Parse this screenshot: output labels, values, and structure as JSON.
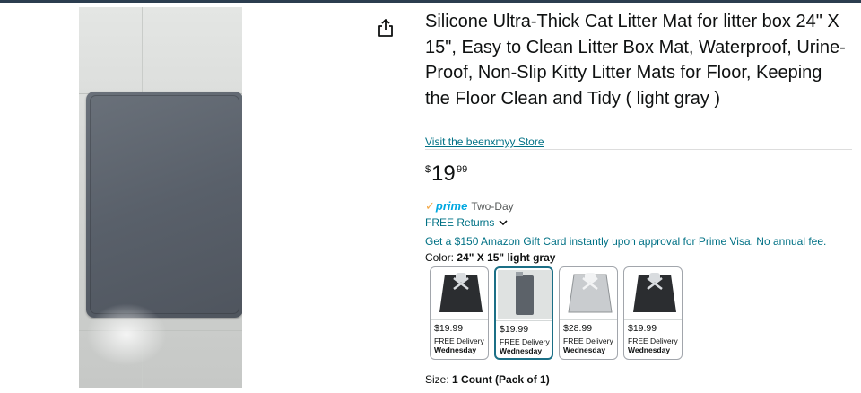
{
  "product": {
    "title": "Silicone Ultra-Thick Cat Litter Mat for litter box 24\" X 15\", Easy to Clean Litter Box Mat, Waterproof, Urine-Proof, Non-Slip Kitty Litter Mats for Floor, Keeping the Floor Clean and Tidy ( light gray )",
    "store_link": "Visit the beenxmyy Store"
  },
  "price": {
    "symbol": "$",
    "whole": "19",
    "fraction": "99"
  },
  "delivery": {
    "prime_check": "✓",
    "prime_word": "prime",
    "prime_speed": "Two-Day",
    "returns": "FREE Returns"
  },
  "offer": "Get a $150 Amazon Gift Card instantly upon approval for Prime Visa. No annual fee.",
  "color": {
    "label": "Color:",
    "value": "24\" X 15\" light gray"
  },
  "swatches": [
    {
      "price": "$19.99",
      "delivery": "FREE Delivery",
      "day": "Wednesday",
      "variant": "black-bone",
      "selected": false
    },
    {
      "price": "$19.99",
      "delivery": "FREE Delivery",
      "day": "Wednesday",
      "variant": "light-gray",
      "selected": true
    },
    {
      "price": "$28.99",
      "delivery": "FREE Delivery",
      "day": "Wednesday",
      "variant": "white-bone",
      "selected": false
    },
    {
      "price": "$19.99",
      "delivery": "FREE Delivery",
      "day": "Wednesday",
      "variant": "black-bone",
      "selected": false
    }
  ],
  "size": {
    "label": "Size:",
    "value": "1 Count (Pack of 1)"
  },
  "icons": {
    "share": "share-icon",
    "returns_chevron": "chevron-down-icon"
  },
  "colors": {
    "link": "#007185",
    "prime_blue": "#00a8e1",
    "prime_check": "#f3a847",
    "selected_border": "#1b6f86"
  }
}
